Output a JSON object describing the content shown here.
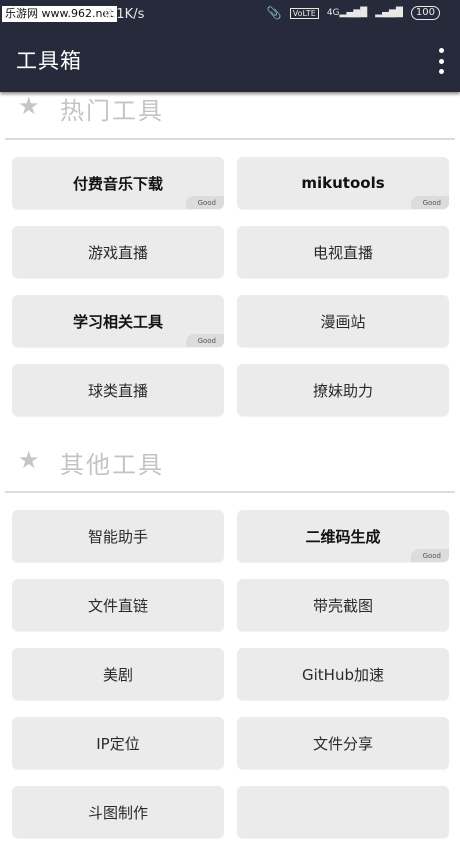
{
  "statusbar": {
    "watermark": "乐游网 www.962.net",
    "net_speed": "0.1K/s",
    "volte": "VoLTE",
    "signal_4g": "4G",
    "battery": "100"
  },
  "appbar": {
    "title": "工具箱",
    "menu_icon": "more-vert-icon"
  },
  "sections": {
    "hot": {
      "title": "热门工具",
      "icon": "star-icon",
      "tools": [
        {
          "label": "付费音乐下载",
          "bold": true,
          "badge": "Good"
        },
        {
          "label": "mikutools",
          "bold": true,
          "badge": "Good"
        },
        {
          "label": "游戏直播",
          "bold": false
        },
        {
          "label": "电视直播",
          "bold": false
        },
        {
          "label": "学习相关工具",
          "bold": true,
          "badge": "Good"
        },
        {
          "label": "漫画站",
          "bold": false
        },
        {
          "label": "球类直播",
          "bold": false
        },
        {
          "label": "撩妹助力",
          "bold": false
        }
      ]
    },
    "other": {
      "title": "其他工具",
      "icon": "star-icon",
      "tools": [
        {
          "label": "智能助手",
          "bold": false
        },
        {
          "label": "二维码生成",
          "bold": true,
          "badge": "Good"
        },
        {
          "label": "文件直链",
          "bold": false
        },
        {
          "label": "带壳截图",
          "bold": false
        },
        {
          "label": "美剧",
          "bold": false
        },
        {
          "label": "GitHub加速",
          "bold": false
        },
        {
          "label": "IP定位",
          "bold": false
        },
        {
          "label": "文件分享",
          "bold": false
        },
        {
          "label": "斗图制作",
          "bold": false
        },
        {
          "label": "",
          "bold": false
        }
      ]
    }
  }
}
